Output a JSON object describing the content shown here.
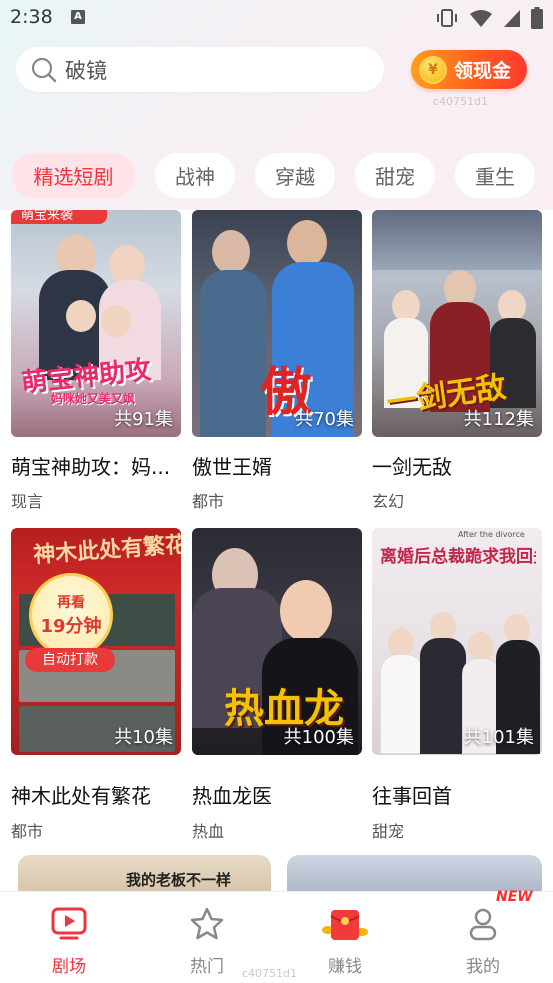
{
  "status_bar": {
    "time": "2:38",
    "notif_letter": "A"
  },
  "search": {
    "placeholder": "破镜"
  },
  "cash_button": {
    "label": "领现金",
    "coin_symbol": "¥"
  },
  "watermark_text": "c40751d1",
  "tabs": [
    {
      "label": "精选短剧",
      "active": true
    },
    {
      "label": "战神",
      "active": false
    },
    {
      "label": "穿越",
      "active": false
    },
    {
      "label": "甜宠",
      "active": false
    },
    {
      "label": "重生",
      "active": false
    }
  ],
  "dramas": [
    {
      "title": "萌宝神助攻：妈...",
      "genre": "现言",
      "episodes": "共91集",
      "poster_text": "萌宝神助攻",
      "poster_sub": "妈咪她又美又飒",
      "top_tag": "萌宝来袭"
    },
    {
      "title": "傲世王婿",
      "genre": "都市",
      "episodes": "共70集",
      "poster_text": "傲"
    },
    {
      "title": "一剑无敌",
      "genre": "玄幻",
      "episodes": "共112集",
      "poster_text": "一剑无敌"
    },
    {
      "title": "神木此处有繁花",
      "genre": "都市",
      "episodes": "共10集",
      "poster_text": "神木此处有繁花"
    },
    {
      "title": "热血龙医",
      "genre": "热血",
      "episodes": "共100集",
      "poster_text": "热血龙"
    },
    {
      "title": "往事回首",
      "genre": "甜宠",
      "episodes": "共101集",
      "poster_text": "离婚后总裁跪求我回头",
      "poster_sub": "After the divorce"
    }
  ],
  "rewatch_badge": {
    "line1": "再看",
    "line2": "19分钟",
    "tag": "自动打款"
  },
  "partial_card_text": "我的老板不一样",
  "bottom_nav": [
    {
      "label": "剧场",
      "icon": "tv-play-icon",
      "active": true
    },
    {
      "label": "热门",
      "icon": "star-icon",
      "active": false
    },
    {
      "label": "赚钱",
      "icon": "red-envelope-icon",
      "active": false
    },
    {
      "label": "我的",
      "icon": "person-icon",
      "active": false
    }
  ],
  "new_badge": "NEW",
  "colors": {
    "accent": "#f0343f",
    "tab_active_bg": "#ffe3e6",
    "cash_gradient_start": "#ff9f1c",
    "cash_gradient_end": "#ff3b2f"
  }
}
